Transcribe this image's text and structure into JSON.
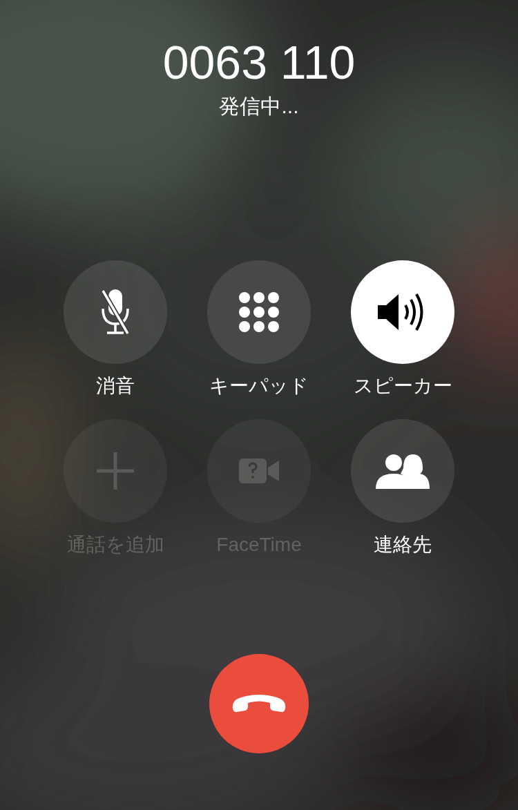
{
  "call": {
    "number": "0063 110",
    "status": "発信中..."
  },
  "buttons": [
    {
      "label": "消音",
      "kind": "mute",
      "selected": false,
      "disabled": false
    },
    {
      "label": "キーパッド",
      "kind": "keypad",
      "selected": false,
      "disabled": false
    },
    {
      "label": "スピーカー",
      "kind": "speaker",
      "selected": true,
      "disabled": false
    },
    {
      "label": "通話を追加",
      "kind": "add",
      "selected": false,
      "disabled": true
    },
    {
      "label": "FaceTime",
      "kind": "facetime",
      "selected": false,
      "disabled": true
    },
    {
      "label": "連絡先",
      "kind": "contacts",
      "selected": false,
      "disabled": false
    }
  ],
  "end_call": {
    "kind": "end"
  }
}
